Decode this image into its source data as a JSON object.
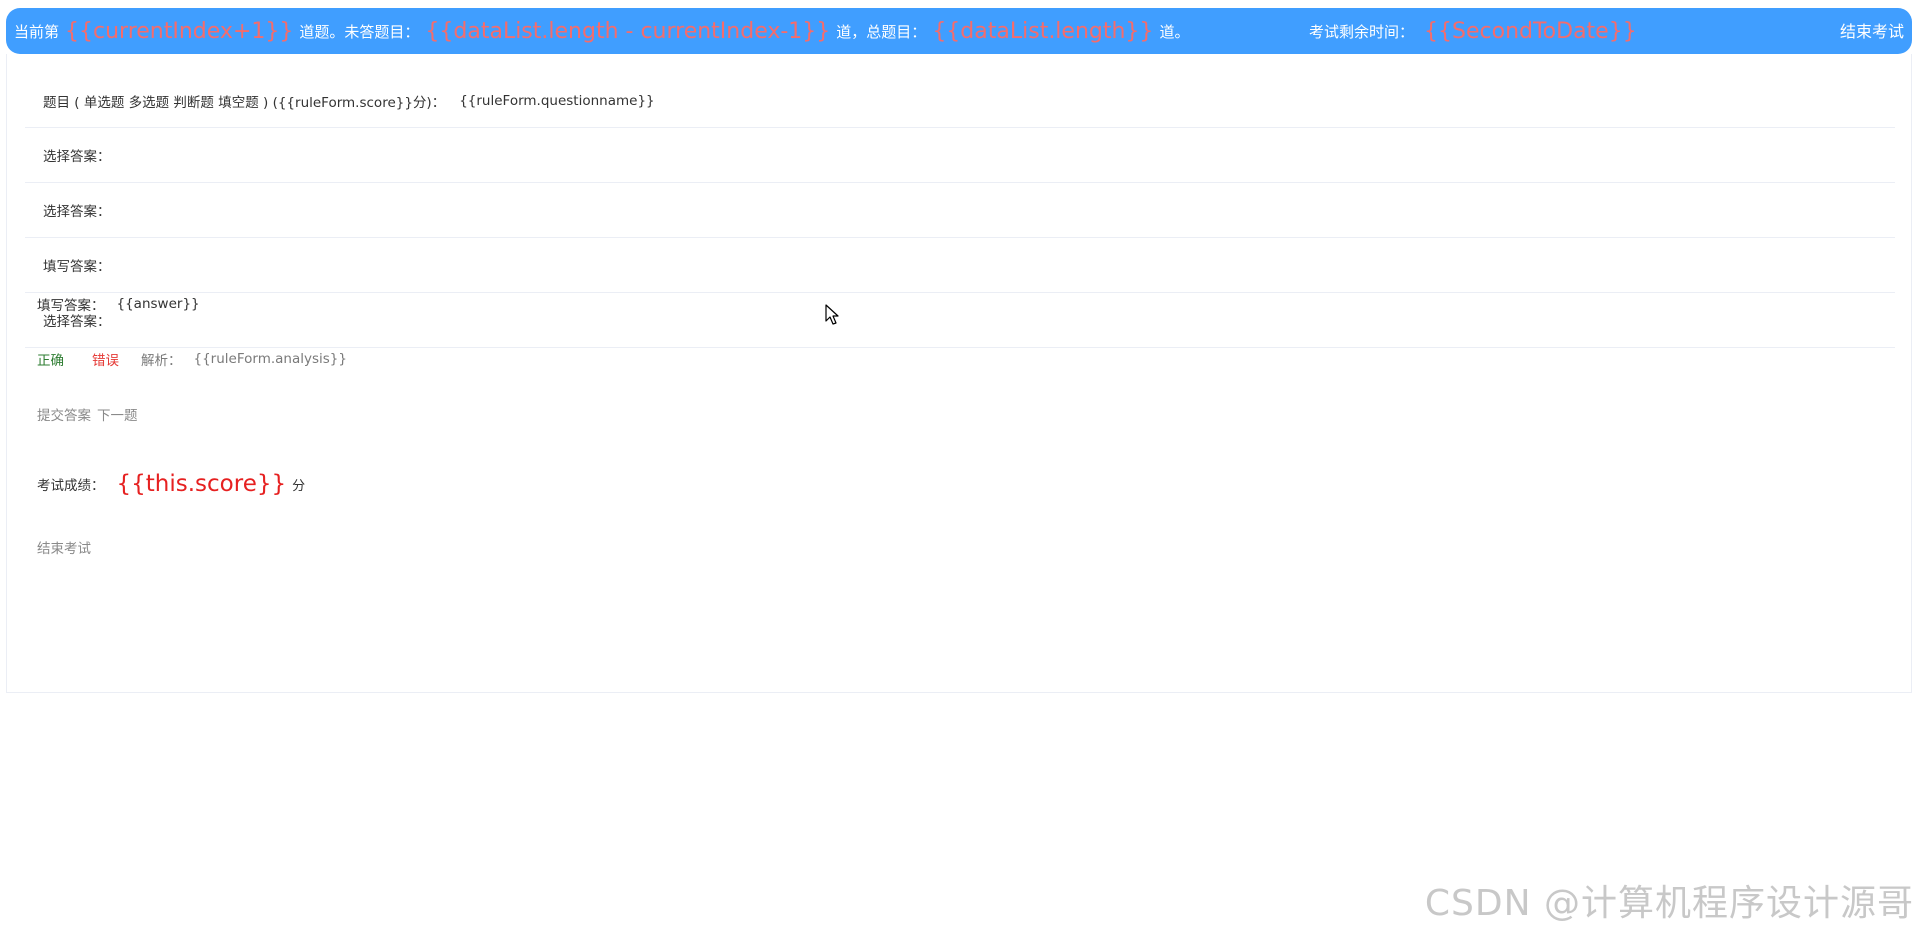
{
  "header": {
    "label_current_prefix": "当前第",
    "var_current": "{{currentIndex+1}}",
    "label_unanswered": "道题。未答题目：",
    "var_unanswered": "{{dataList.length - currentIndex-1}}",
    "label_total": "道，总题目：",
    "var_total": "{{dataList.length}}",
    "label_total_suffix": "道。",
    "label_time": "考试剩余时间：",
    "var_time": "{{SecondToDate}}",
    "end_button": "结束考试"
  },
  "question": {
    "label": "题目 ( 单选题 多选题 判断题 填空题 ) ({{ruleForm.score}}分)：",
    "value": "{{ruleForm.questionname}}"
  },
  "answers": [
    {
      "label": "选择答案："
    },
    {
      "label": "选择答案："
    },
    {
      "label": "填写答案："
    },
    {
      "label": "选择答案："
    }
  ],
  "filled": {
    "label": "填写答案：",
    "value": "{{answer}}"
  },
  "result": {
    "correct": "正确",
    "wrong": "错误",
    "analysis_label": "解析：",
    "analysis_value": "{{ruleForm.analysis}}"
  },
  "actions": {
    "submit": "提交答案",
    "next": "下一题"
  },
  "score": {
    "label": "考试成绩：",
    "value": "{{this.score}}",
    "unit": "分"
  },
  "end_exam": "结束考试",
  "watermark": "CSDN @计算机程序设计源哥",
  "colors": {
    "header_bg": "#409eff",
    "variable_red": "#f56c6c",
    "correct_green": "#2e7d32",
    "wrong_red": "#e53935"
  }
}
